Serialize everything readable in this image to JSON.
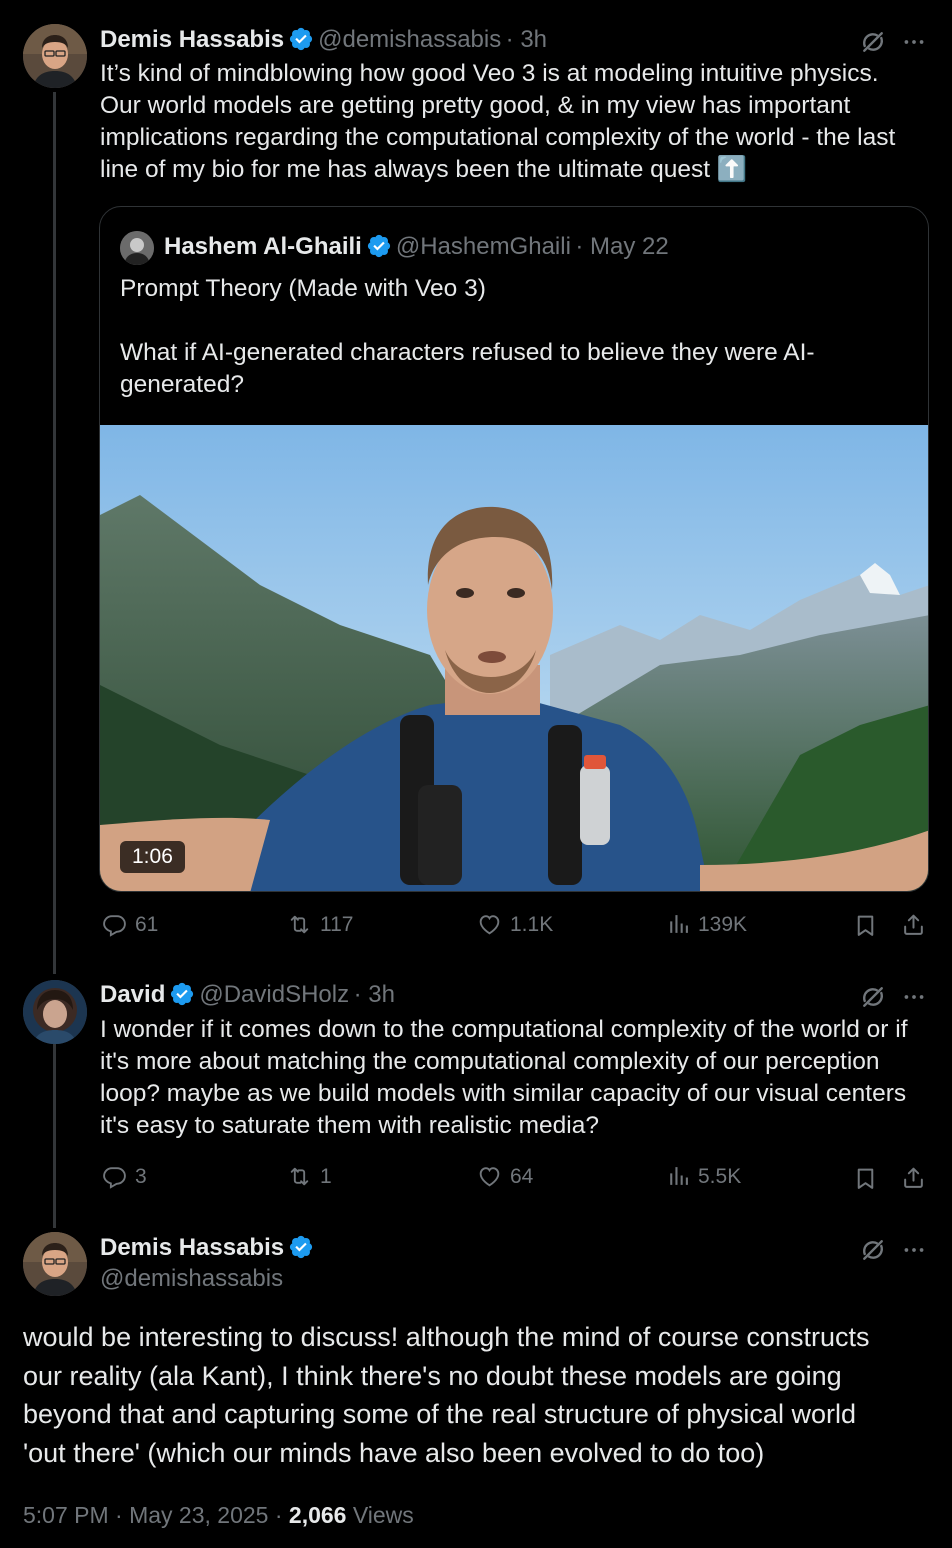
{
  "tweet1": {
    "name": "Demis Hassabis",
    "handle": "@demishassabis",
    "time": "· 3h",
    "text_lines": [
      "It’s kind of mindblowing how good Veo 3 is at modeling intuitive physics.",
      "Our world models are getting pretty good, & in my view has important",
      "implications regarding the computational complexity of the world - the last",
      "line of my bio for me has always been the ultimate quest ⬆️"
    ],
    "quote": {
      "name": "Hashem Al-Ghaili",
      "handle": "@HashemGhaili",
      "time": "· May 22",
      "line1": "Prompt Theory (Made with Veo 3)",
      "line2": "What if AI-generated characters refused to believe they were AI-",
      "line3": "generated?",
      "duration": "1:06"
    },
    "stats": {
      "replies": "61",
      "reposts": "117",
      "likes": "1.1K",
      "views": "139K"
    }
  },
  "tweet2": {
    "name": "David",
    "handle": "@DavidSHolz",
    "time": "· 3h",
    "text_lines": [
      "I wonder if it comes down to the computational complexity of the world or if",
      "it's more about matching the computational complexity of our perception",
      "loop? maybe as we build models with similar capacity of our visual centers",
      "it's easy to saturate them with realistic media?"
    ],
    "stats": {
      "replies": "3",
      "reposts": "1",
      "likes": "64",
      "views": "5.5K"
    }
  },
  "tweet3": {
    "name": "Demis Hassabis",
    "handle": "@demishassabis",
    "text_lines": [
      "would be interesting to discuss! although the mind of course constructs",
      "our reality (ala Kant), I think there's no doubt these models are going",
      "beyond that and capturing some of the real structure of physical world",
      "'out there' (which our minds have also been evolved to do too)"
    ],
    "footer": {
      "time": "5:07 PM · May 23, 2025 ·",
      "views_count": "2,066",
      "views_label": "Views"
    }
  },
  "colors": {
    "background": "#000000",
    "text": "#e7e9ea",
    "muted": "#71767b",
    "verified": "#1d9bf0",
    "border": "#2f3336"
  },
  "icons": [
    "grok-icon",
    "more-icon",
    "reply-icon",
    "repost-icon",
    "like-icon",
    "views-icon",
    "bookmark-icon",
    "share-icon",
    "verified-icon"
  ]
}
